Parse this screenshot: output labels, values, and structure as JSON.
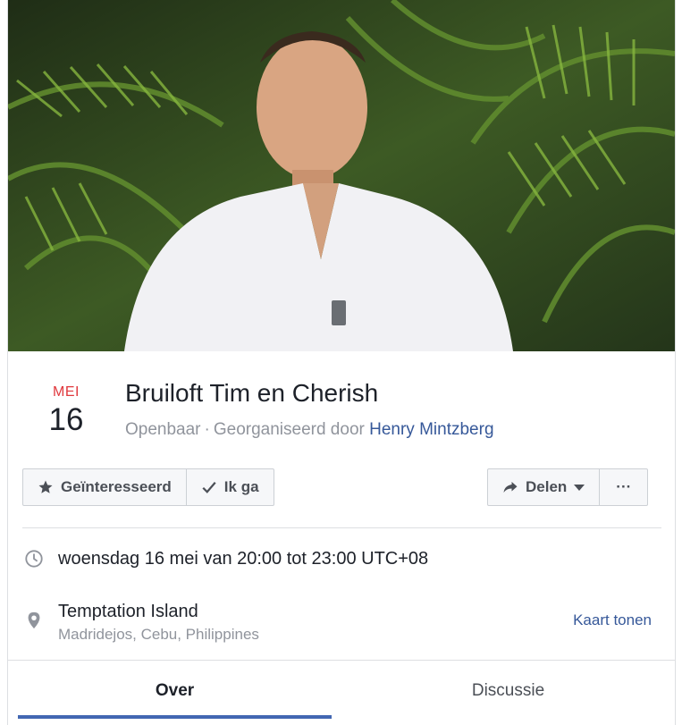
{
  "event": {
    "month": "MEI",
    "day": "16",
    "title": "Bruiloft Tim en Cherish",
    "privacy": "Openbaar",
    "separator": "·",
    "organizer_prefix": "Georganiseerd door",
    "organizer_name": "Henry Mintzberg"
  },
  "actions": {
    "interested_label": "Geïnteresseerd",
    "going_label": "Ik ga",
    "share_label": "Delen",
    "more_label": "···"
  },
  "details": {
    "time": "woensdag 16 mei van 20:00 tot 23:00 UTC+08",
    "location_name": "Temptation Island",
    "location_address": "Madridejos, Cebu, Philippines",
    "map_link": "Kaart tonen"
  },
  "tabs": [
    {
      "label": "Over",
      "active": true
    },
    {
      "label": "Discussie",
      "active": false
    }
  ],
  "icons": {
    "interested": "star-icon",
    "going": "checkmark-icon",
    "share": "share-arrow-icon",
    "time": "clock-icon",
    "location": "map-pin-icon"
  },
  "colors": {
    "month": "#e0393e",
    "link": "#365899",
    "tab_indicator": "#4267b2"
  }
}
